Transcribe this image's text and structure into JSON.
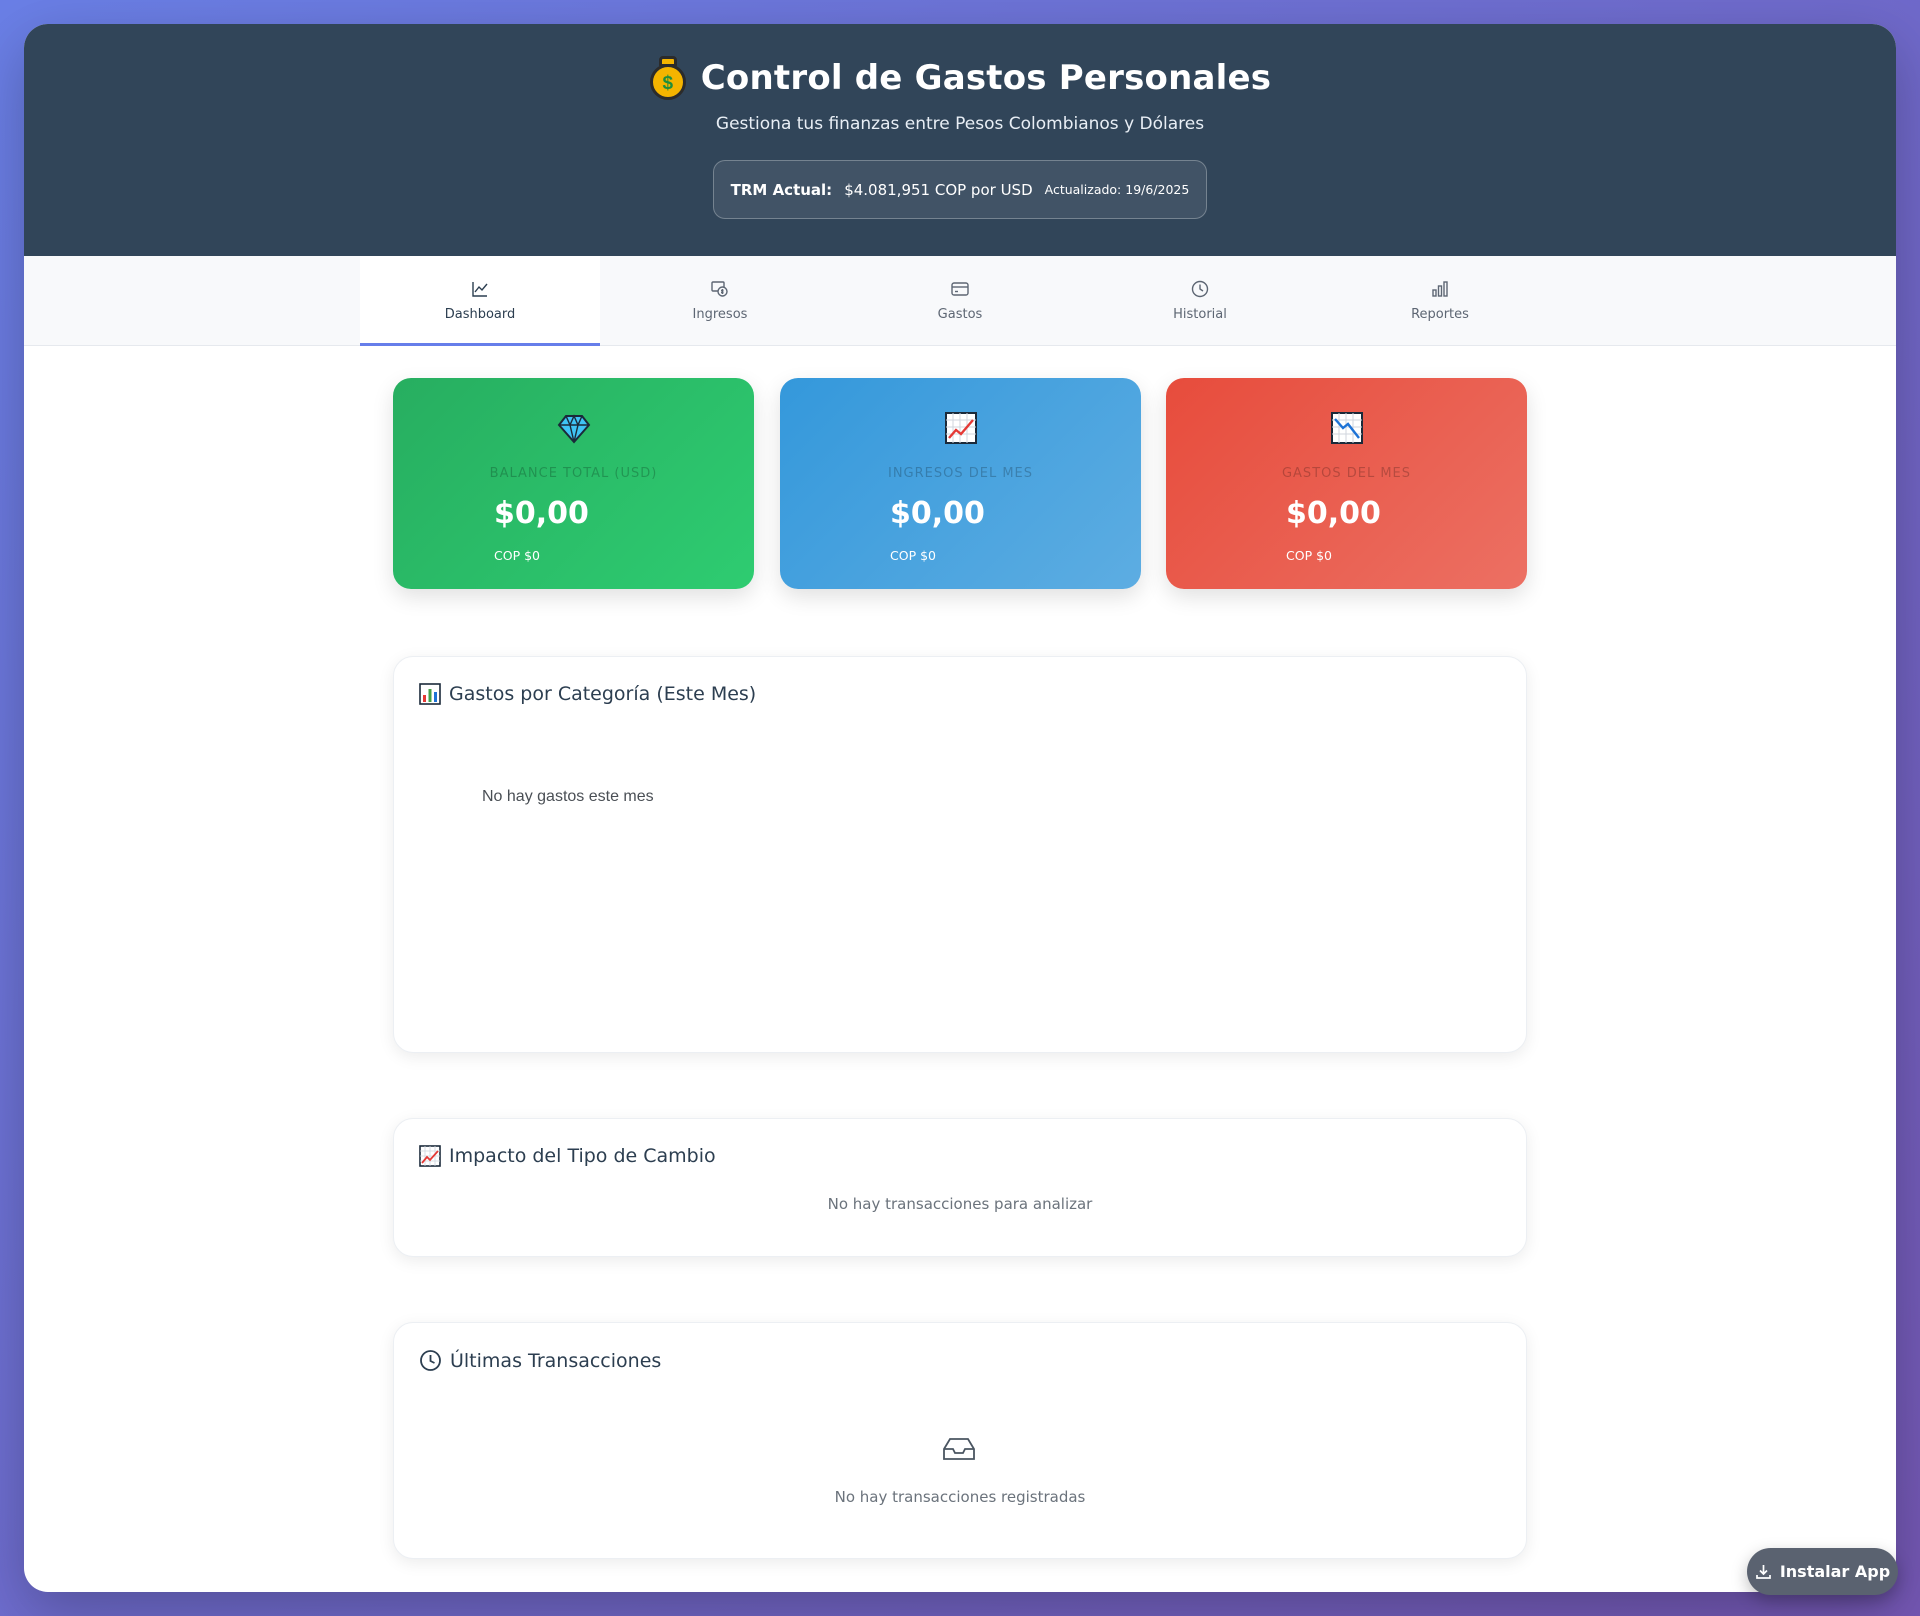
{
  "header": {
    "title": "Control de Gastos Personales",
    "subtitle": "Gestiona tus finanzas entre Pesos Colombianos y Dólares",
    "trm": {
      "label": "TRM Actual:",
      "value": "$4.081,951 COP por USD",
      "updated": "Actualizado: 19/6/2025"
    }
  },
  "tabs": [
    {
      "label": "Dashboard",
      "icon": "chart-line-icon",
      "active": true
    },
    {
      "label": "Ingresos",
      "icon": "money-exchange-icon",
      "active": false
    },
    {
      "label": "Gastos",
      "icon": "credit-card-icon",
      "active": false
    },
    {
      "label": "Historial",
      "icon": "clock-icon",
      "active": false
    },
    {
      "label": "Reportes",
      "icon": "bar-chart-icon",
      "active": false
    }
  ],
  "cards": [
    {
      "label": "BALANCE TOTAL (USD)",
      "amount": "$0,00",
      "cop": "COP $0",
      "icon": "gem-icon",
      "color": "#27ae60"
    },
    {
      "label": "INGRESOS DEL MES",
      "amount": "$0,00",
      "cop": "COP $0",
      "icon": "chart-increasing-icon",
      "color": "#3498db"
    },
    {
      "label": "GASTOS DEL MES",
      "amount": "$0,00",
      "cop": "COP $0",
      "icon": "chart-decreasing-icon",
      "color": "#e74c3c"
    }
  ],
  "panels": {
    "categories": {
      "title": "Gastos por Categoría (Este Mes)",
      "empty": "No hay gastos este mes"
    },
    "exchange": {
      "title": "Impacto del Tipo de Cambio",
      "empty": "No hay transacciones para analizar"
    },
    "transactions": {
      "title": "Últimas Transacciones",
      "empty": "No hay transacciones registradas"
    }
  },
  "install_button": {
    "label": "Instalar App"
  }
}
